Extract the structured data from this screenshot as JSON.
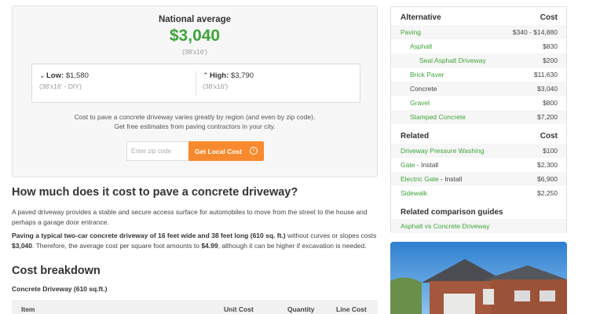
{
  "estimate": {
    "title": "National average",
    "value": "$3,040",
    "dims": "(38'x16')",
    "low_label": "Low:",
    "low_value": "$1,580",
    "low_sub": "(38'x16' - DIY)",
    "high_label": "High:",
    "high_value": "$3,790",
    "high_sub": "(38'x16')",
    "desc_line1": "Cost to pave a concrete driveway varies greatly by region (and even by zip code).",
    "desc_line2": "Get free estimates from paving contractors in your city.",
    "zip_placeholder": "Enter zip code",
    "button_label": "Get Local Cost"
  },
  "article": {
    "heading": "How much does it cost to pave a concrete driveway?",
    "para1": "A paved driveway provides a stable and secure access surface for automobiles to move from the street to the house and perhaps a garage door entrance.",
    "para2_bold": "Paving a typical two-car concrete driveway of 16 feet wide and 38 feet long (610 sq. ft.)",
    "para2_mid": " without curves or slopes costs ",
    "para2_cost": "$3,040",
    "para2_after": ". Therefore, the average cost per square foot amounts to ",
    "para2_sqft": "$4.99",
    "para2_end": ", although it can be higher if excavation is needed.",
    "breakdown_heading": "Cost breakdown",
    "breakdown_sub": "Concrete Driveway (610 sq.ft.)",
    "columns": [
      "Item",
      "Unit Cost",
      "Quantity",
      "Line Cost"
    ]
  },
  "sidebar": {
    "alt_header": "Alternative",
    "cost_header": "Cost",
    "alternatives": [
      {
        "label": "Paving",
        "value": "$340 - $14,880"
      },
      {
        "label": "Asphalt",
        "value": "$830"
      },
      {
        "label": "Seal Asphalt Driveway",
        "value": "$200"
      },
      {
        "label": "Brick Paver",
        "value": "$11,630"
      },
      {
        "label": "Concrete",
        "value": "$3,040"
      },
      {
        "label": "Gravel",
        "value": "$800"
      },
      {
        "label": "Stamped Concrete",
        "value": "$7,200"
      }
    ],
    "related_header": "Related",
    "related": [
      {
        "label": "Driveway Pressure Washing",
        "value": "$100"
      },
      {
        "label": "Gate",
        "suffix": " - Install",
        "value": "$2,300"
      },
      {
        "label": "Electric Gate",
        "suffix": " - Install",
        "value": "$6,900"
      },
      {
        "label": "Sidewalk",
        "value": "$2,250"
      }
    ],
    "guides_header": "Related comparison guides",
    "guide": "Asphalt vs Concrete Driveway"
  },
  "colors": {
    "accent_green": "#3fa33a",
    "button_orange": "#f78a2e"
  }
}
